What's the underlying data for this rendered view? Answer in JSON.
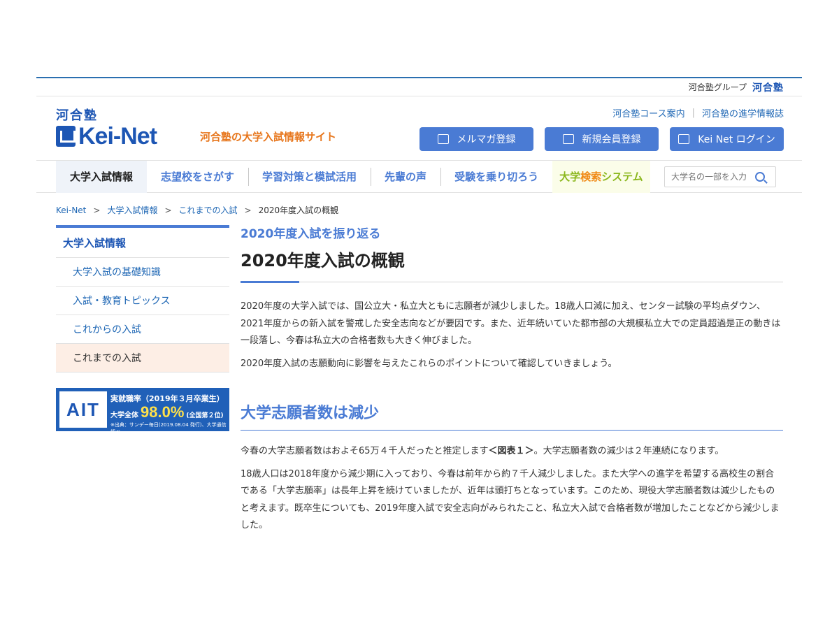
{
  "header": {
    "group_label": "河合塾グループ",
    "group_brand": "河合塾",
    "logo_kanji": "河合塾",
    "logo_text_a": "Kei",
    "logo_text_dash": "-",
    "logo_text_b": "Net",
    "tagline": "河合塾の大学入試情報サイト",
    "util_links": [
      "河合塾コース案内",
      "河合塾の進学情報誌"
    ],
    "buttons": [
      "メルマガ登録",
      "新規会員登録",
      "Kei Net ログイン"
    ]
  },
  "gnav": {
    "items": [
      "大学入試情報",
      "志望校をさがす",
      "学習対策と模試活用",
      "先輩の声",
      "受験を乗り切ろう"
    ],
    "search_system_a": "大学",
    "search_system_b": "検索",
    "search_system_c": "システム",
    "search_placeholder": "大学名の一部を入力"
  },
  "breadcrumb": [
    "Kei-Net",
    "大学入試情報",
    "これまでの入試",
    "2020年度入試の概観"
  ],
  "sidebar": {
    "title": "大学入試情報",
    "items": [
      "大学入試の基礎知識",
      "入試・教育トピックス",
      "これからの入試",
      "これまでの入試"
    ]
  },
  "ad": {
    "logo": "AIT",
    "line1": "実就職率（2019年３月卒業生）",
    "line2_label": "大学全体",
    "rate": "98.0%",
    "rank": "(全国第２位)",
    "source": "※出典：サンデー毎日(2019.08.04 発行)、大学通信調べ"
  },
  "article": {
    "subtitle": "2020年度入試を振り返る",
    "title": "2020年度入試の概観",
    "intro1": "2020年度の大学入試では、国公立大・私立大ともに志願者が減少しました。18歳人口減に加え、センター試験の平均点ダウン、2021年度からの新入試を警戒した安全志向などが要因です。また、近年続いていた都市部の大規模私立大での定員超過是正の動きは一段落し、今春は私立大の合格者数も大きく伸びました。",
    "intro2": "2020年度入試の志願動向に影響を与えたこれらのポイントについて確認していきましょう。",
    "section1_title": "大学志願者数は減少",
    "s1p1_a": "今春の大学志願者数はおよそ65万４千人だったと推定します",
    "s1p1_ref": "＜図表１＞",
    "s1p1_b": "。大学志願者数の減少は２年連続になります。",
    "s1p2": "18歳人口は2018年度から減少期に入っており、今春は前年から約７千人減少しました。また大学への進学を希望する高校生の割合である「大学志願率」は長年上昇を続けていましたが、近年は頭打ちとなっています。このため、現役大学志願者数は減少したものと考えます。既卒生についても、2019年度入試で安全志向がみられたこと、私立大入試で合格者数が増加したことなどから減少しました。"
  }
}
